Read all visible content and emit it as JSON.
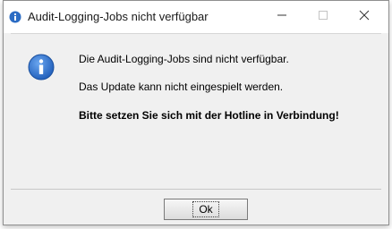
{
  "window": {
    "title": "Audit-Logging-Jobs nicht verfügbar",
    "title_icon": "info-icon",
    "controls": {
      "minimize": "minimize-icon",
      "maximize": "maximize-icon",
      "close": "close-icon"
    }
  },
  "dialog": {
    "icon": "info-icon",
    "messages": [
      "Die Audit-Logging-Jobs sind nicht verfügbar.",
      "Das Update kann nicht eingespielt werden.",
      "Bitte setzen Sie sich mit der Hotline in Verbindung!"
    ],
    "ok_label": "Ok"
  },
  "colors": {
    "accent": "#2b6cc4",
    "dialog_background": "#f0f0f0",
    "titlebar_background": "#ffffff"
  }
}
